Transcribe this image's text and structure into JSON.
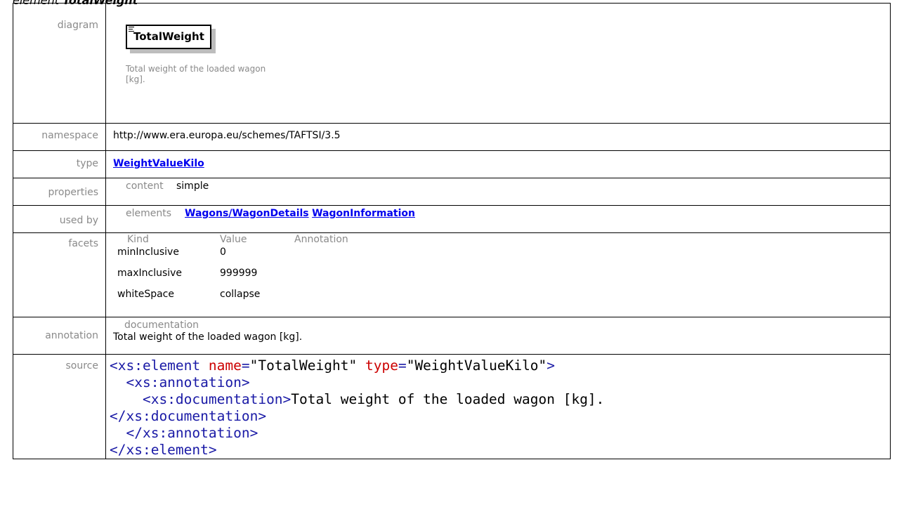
{
  "heading": {
    "label": "element",
    "name": "TotalWeight"
  },
  "labels": {
    "diagram": "diagram",
    "namespace": "namespace",
    "type": "type",
    "properties": "properties",
    "used_by": "used by",
    "facets": "facets",
    "annotation": "annotation",
    "source": "source"
  },
  "diagram": {
    "element_name": "TotalWeight",
    "doc": "Total weight of the loaded wagon [kg]."
  },
  "namespace": "http://www.era.europa.eu/schemes/TAFTSI/3.5",
  "type": "WeightValueKilo",
  "properties": {
    "key": "content",
    "value": "simple"
  },
  "used_by": {
    "key": "elements",
    "links": [
      "Wagons/WagonDetails",
      "WagonInformation"
    ]
  },
  "facets": {
    "headers": [
      "Kind",
      "Value",
      "Annotation"
    ],
    "rows": [
      {
        "kind": "minInclusive",
        "value": "0"
      },
      {
        "kind": "maxInclusive",
        "value": "999999"
      },
      {
        "kind": "whiteSpace",
        "value": "collapse"
      }
    ]
  },
  "annotation": {
    "key": "documentation",
    "text": "Total weight of the loaded wagon [kg]."
  },
  "source": {
    "line1_open": "<xs:element",
    "line1_attr1": "name",
    "line1_val1": "\"TotalWeight\"",
    "line1_attr2": "type",
    "line1_val2": "\"WeightValueKilo\"",
    "line1_close": ">",
    "line2": "<xs:annotation>",
    "line3_open": "<xs:documentation>",
    "line3_text": "Total weight of the loaded wagon [kg].",
    "line4": "</xs:documentation>",
    "line5": "</xs:annotation>",
    "line6": "</xs:element>"
  }
}
